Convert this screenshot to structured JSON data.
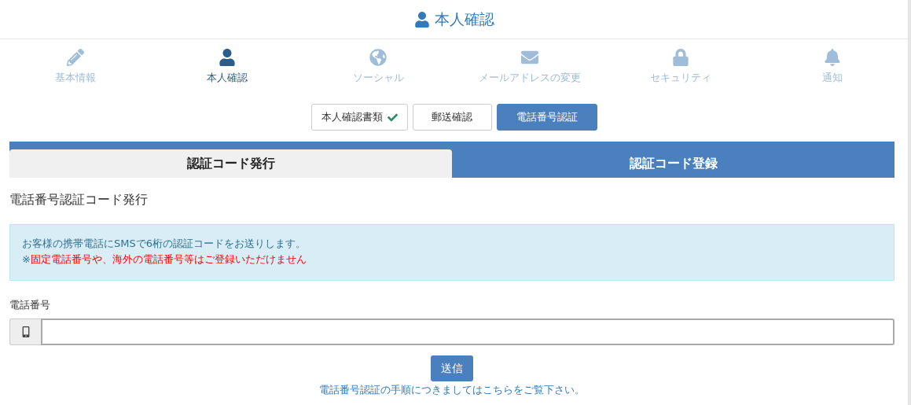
{
  "header": {
    "title": "本人確認"
  },
  "nav": [
    {
      "label": "基本情報",
      "selected": false
    },
    {
      "label": "本人確認",
      "selected": true
    },
    {
      "label": "ソーシャル",
      "selected": false
    },
    {
      "label": "メールアドレスの変更",
      "selected": false
    },
    {
      "label": "セキュリティ",
      "selected": false
    },
    {
      "label": "通知",
      "selected": false
    }
  ],
  "steps": [
    {
      "label": "本人確認書類",
      "done": true,
      "selected": false
    },
    {
      "label": "郵送確認",
      "done": false,
      "selected": false
    },
    {
      "label": "電話番号認証",
      "done": false,
      "selected": true
    }
  ],
  "tabs": [
    {
      "label": "認証コード発行",
      "selected": true
    },
    {
      "label": "認証コード登録",
      "selected": false
    }
  ],
  "section_title": "電話番号認証コード発行",
  "info": {
    "line": "お客様の携帯電話にSMSで6桁の認証コードをお送りします。",
    "note_mark": "※",
    "note": "固定電話番号や、海外の電話番号等はご登録いただけません"
  },
  "phone_field": {
    "label": "電話番号"
  },
  "submit": "送信",
  "help_link": "電話番号認証の手順につきましてはこちらをご覧下さい。"
}
